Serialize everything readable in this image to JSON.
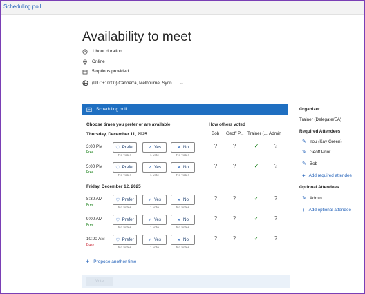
{
  "app_title": "Scheduling poll",
  "meeting": {
    "title": "Availability to meet",
    "duration": "1 hour duration",
    "location": "Online",
    "options": "5 options provided",
    "timezone": "(UTC+10:00) Canberra, Melbourne, Sydn..."
  },
  "banner_label": "Scheduling poll",
  "left_header": "Choose times you prefer or are available",
  "right_header": "How others voted",
  "columns": [
    "Bob",
    "Geoff P...",
    "Trainer (...",
    "Admin"
  ],
  "vote_labels": {
    "prefer": "Prefer",
    "yes": "Yes",
    "no": "No"
  },
  "dates": [
    {
      "label": "Thursday, December 11, 2025",
      "slots": [
        {
          "time": "3:00 PM",
          "status": "Free",
          "counts": [
            "No votes",
            "1 vote",
            "No votes"
          ],
          "others": [
            "?",
            "?",
            "✓",
            "?"
          ]
        },
        {
          "time": "5:00 PM",
          "status": "Free",
          "counts": [
            "No votes",
            "1 vote",
            "No votes"
          ],
          "others": [
            "?",
            "?",
            "✓",
            "?"
          ]
        }
      ]
    },
    {
      "label": "Friday, December 12, 2025",
      "slots": [
        {
          "time": "8:30 AM",
          "status": "Free",
          "counts": [
            "No votes",
            "1 vote",
            "No votes"
          ],
          "others": [
            "?",
            "?",
            "✓",
            "?"
          ]
        },
        {
          "time": "9:00 AM",
          "status": "Free",
          "counts": [
            "No votes",
            "1 vote",
            "No votes"
          ],
          "others": [
            "?",
            "?",
            "✓",
            "?"
          ]
        },
        {
          "time": "10:00 AM",
          "status": "Busy",
          "counts": [
            "No votes",
            "1 vote",
            "No votes"
          ],
          "others": [
            "?",
            "?",
            "✓",
            "?"
          ]
        }
      ]
    }
  ],
  "propose_label": "Propose another time",
  "vote_button": "Vote",
  "sidebar": {
    "organizer_label": "Organizer",
    "organizer": "Trainer (Delegate/EA)",
    "required_label": "Required Attendees",
    "required": [
      "You (Kay Green)",
      "Geoff Prior",
      "Bob"
    ],
    "add_required": "Add required attendee",
    "optional_label": "Optional Attendees",
    "optional": [
      "Admin"
    ],
    "add_optional": "Add optional attendee"
  }
}
